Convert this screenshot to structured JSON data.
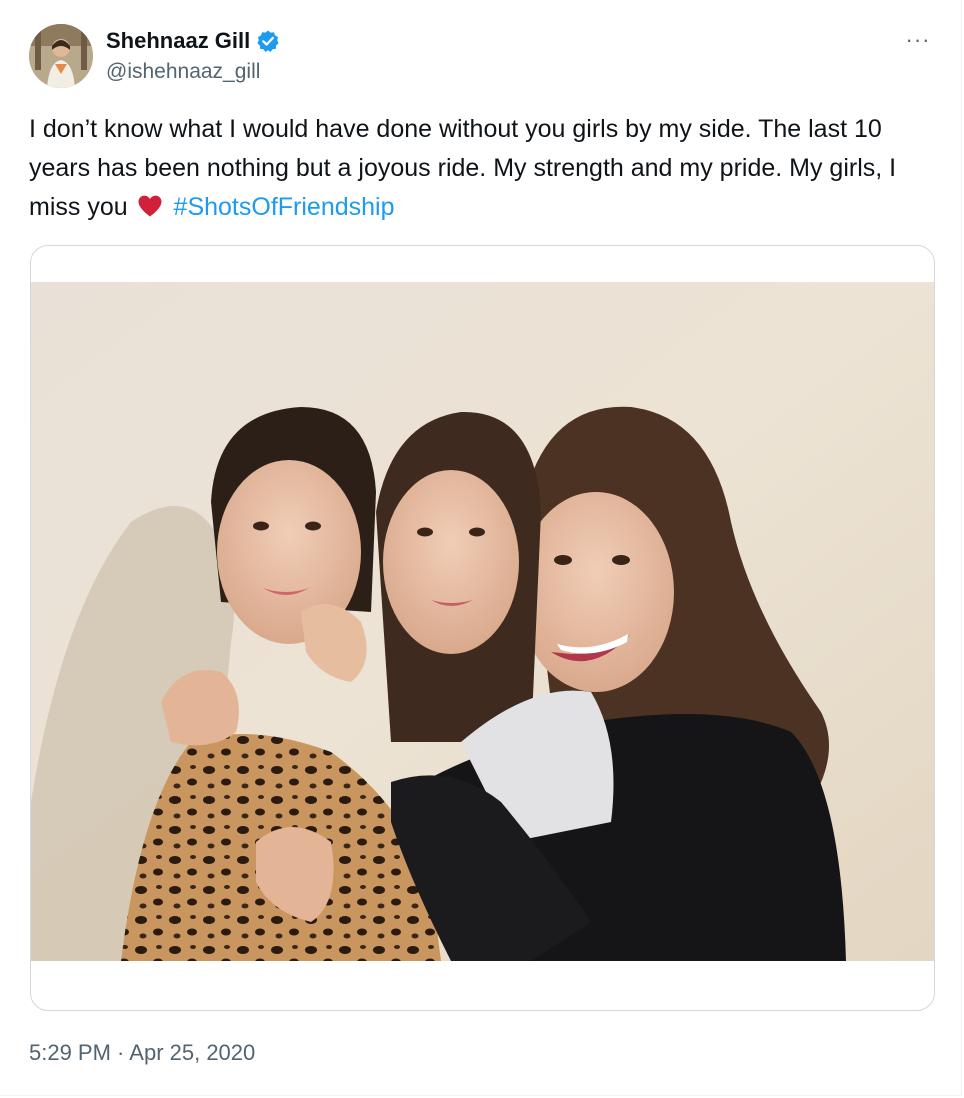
{
  "author": {
    "display_name": "Shehnaaz Gill",
    "handle": "@ishehnaaz_gill",
    "verified": true,
    "avatar_icon": "profile-photo"
  },
  "menu": {
    "more_label": "···"
  },
  "tweet": {
    "text_before_emoji": "I don’t know what I would have done without you girls by my side. The last 10 years has been nothing but a joyous ride. My strength and my pride. My girls, I miss you",
    "emoji": "red-heart-icon",
    "hashtag": "#ShotsOfFriendship"
  },
  "media": {
    "type": "photo",
    "people_count": 3
  },
  "meta": {
    "time": "5:29 PM",
    "separator": " · ",
    "date": "Apr 25, 2020"
  },
  "colors": {
    "link": "#1d9bf0",
    "text": "#0f1419",
    "secondary": "#536471",
    "verified": "#1d9bf0",
    "heart": "#d1213a"
  }
}
